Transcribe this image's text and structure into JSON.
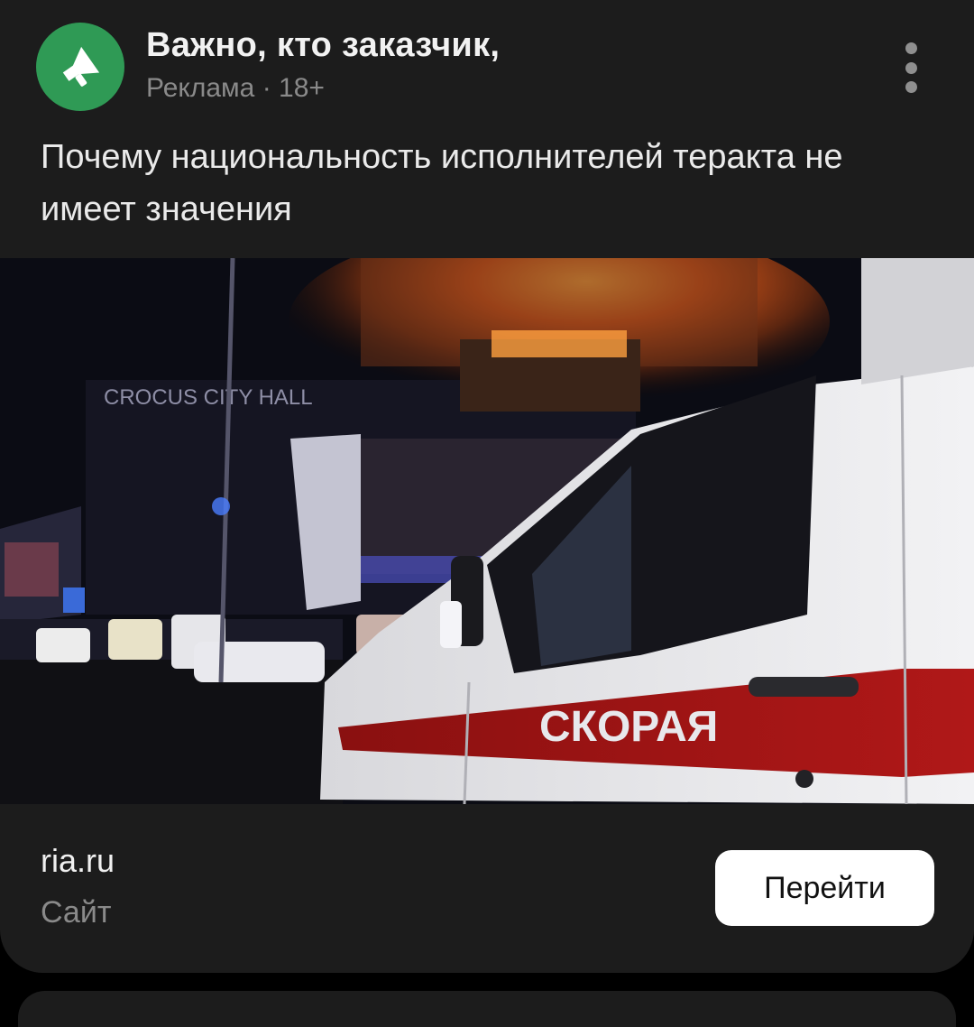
{
  "ad": {
    "advertiser_title": "Важно, кто заказчик,",
    "label": "Реклама",
    "separator": "·",
    "age_rating": "18+",
    "headline": "Почему национальность исполнителей теракта не имеет значения",
    "avatar_icon": "megaphone-icon",
    "menu_icon": "more-vertical-icon"
  },
  "photo": {
    "sign_text": "CROCUS CITY HALL",
    "vehicle_text": "СКОРАЯ"
  },
  "footer": {
    "domain": "ria.ru",
    "type_label": "Сайт",
    "cta_label": "Перейти"
  },
  "colors": {
    "card_bg": "#1c1c1c",
    "avatar_green": "#2f9a55",
    "button_bg": "#ffffff"
  }
}
